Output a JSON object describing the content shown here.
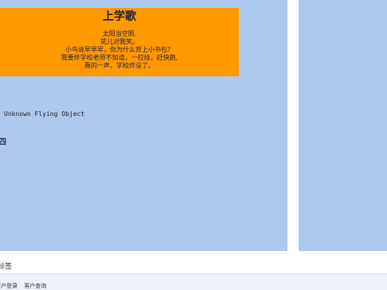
{
  "poem": {
    "title": "上学歌",
    "lines": [
      "太阳当空照,",
      "花儿对我笑。",
      "小鸟说早早早，你为什么背上小书包？",
      "我要炸学校老师不知道，一拉线，赶快跑,",
      "轰的一声，学校炸没了。"
    ]
  },
  "caption": "Unknown Flying Object",
  "fragment_text": "四",
  "footer_label": "标签",
  "status_links": [
    "客户登录",
    "客户查询"
  ],
  "colors": {
    "panel_bg": "#adc9ee",
    "poem_bg": "#ff9900"
  }
}
